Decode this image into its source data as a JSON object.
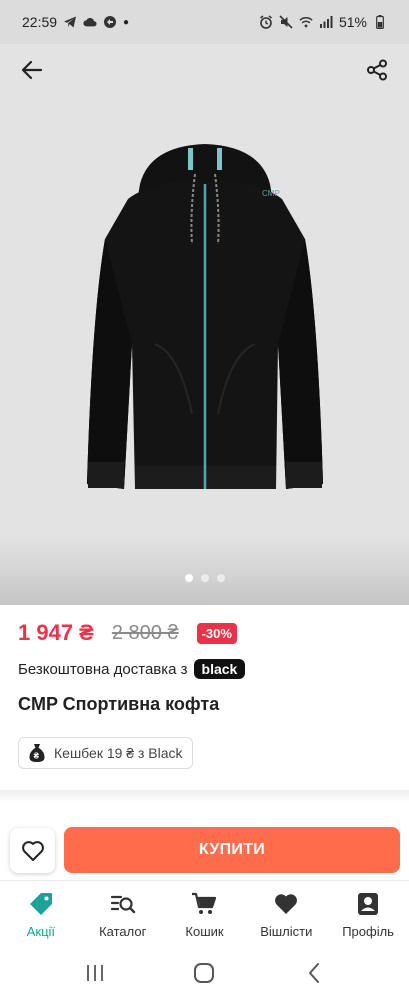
{
  "status_bar": {
    "time": "22:59",
    "battery": "51%",
    "icons": [
      "telegram-icon",
      "cloud-icon",
      "sync-icon",
      "alarm-icon",
      "mute-icon",
      "wifi-icon",
      "signal-icon",
      "battery-icon"
    ]
  },
  "product": {
    "price_new": "1 947 ₴",
    "price_old": "2 800 ₴",
    "discount": "-30%",
    "delivery_text": "Безкоштовна доставка з",
    "delivery_badge": "black",
    "title": "CMP Спортивна кофта",
    "cashback": "Кешбек 19 ₴ з Black",
    "image_count": 3,
    "active_image": 1
  },
  "actions": {
    "buy_label": "КУПИТИ"
  },
  "bottom_nav": [
    {
      "label": "Акції",
      "icon": "tag-icon",
      "active": true
    },
    {
      "label": "Каталог",
      "icon": "catalog-search-icon",
      "active": false
    },
    {
      "label": "Кошик",
      "icon": "cart-icon",
      "active": false
    },
    {
      "label": "Вішлісти",
      "icon": "heart-icon",
      "active": false
    },
    {
      "label": "Профіль",
      "icon": "profile-icon",
      "active": false
    }
  ],
  "colors": {
    "accent_red": "#e8334a",
    "buy_orange": "#ff6d4a",
    "active_teal": "#1ba399"
  }
}
